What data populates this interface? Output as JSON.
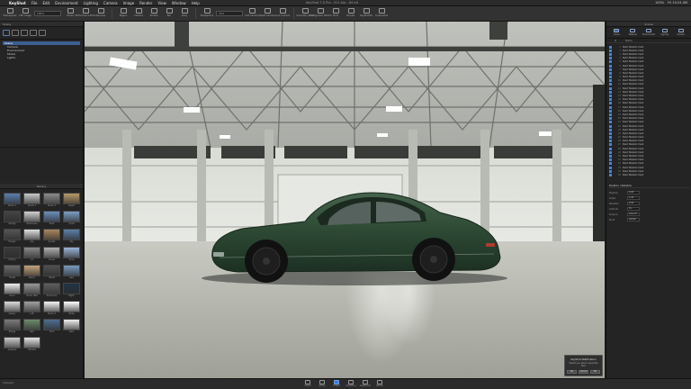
{
  "menubar": {
    "app": "KeyShot",
    "menus": [
      "File",
      "Edit",
      "Environment",
      "Lighting",
      "Camera",
      "Image",
      "Render",
      "View",
      "Window",
      "Help"
    ],
    "title": "KeyShot 7.0 Pro - 911.bip - 64 bit",
    "status": [
      "100%",
      "Fri 10:24 AM"
    ]
  },
  "toolbar": {
    "items": [
      "Workspaces",
      "CPU Usage",
      "Pause",
      "Performance Mode",
      "Denoise",
      "Region",
      "Camera",
      "Tumble",
      "Pan",
      "Dolly",
      "Perspective",
      "Add Camera",
      "Reset Camera",
      "Lock Camera",
      "Geometry View",
      "Configurator Wizard",
      "Tools",
      "Render",
      "KeyShotVR",
      "Screenshot"
    ],
    "cpu_value": "100%",
    "fov_value": "30.0"
  },
  "left_panel": {
    "title": "Scene",
    "tree": [
      "Scene",
      "Camera",
      "Environment",
      "Model",
      "Lights"
    ],
    "library_title": "Library",
    "library_items": [
      "Studio 1",
      "Studio 2",
      "Studio 3",
      "Desert",
      "Garage",
      "Warehouse",
      "Road",
      "Coast",
      "Hangar",
      "City",
      "Sunset",
      "Sky",
      "Factory",
      "Lot",
      "Tunnel",
      "Snow",
      "Forest",
      "Beach",
      "Street",
      "Lake",
      "Room",
      "Studio HDR",
      "Showroom",
      "Night",
      "Gallery",
      "Loft",
      "Studio 4",
      "White",
      "Bridge",
      "Park",
      "Dock",
      "Plain",
      "Gradient",
      "Soft Box"
    ]
  },
  "right_panel": {
    "title": "Scene",
    "tabs": [
      "Scene",
      "Material",
      "Environment",
      "Lighting",
      "Camera"
    ],
    "columns": [
      "",
      "#",
      "Name"
    ],
    "materials": [
      "Paint Metallic Dark",
      "Paint Metallic Dark",
      "Paint Metallic Dark",
      "Paint Metallic Dark",
      "Paint Metallic Dark",
      "Paint Metallic Dark",
      "Paint Metallic Dark",
      "Paint Metallic Dark",
      "Paint Metallic Dark",
      "Paint Metallic Dark",
      "Paint Metallic Dark",
      "Paint Metallic Dark",
      "Paint Metallic Dark",
      "Paint Metallic Dark",
      "Paint Metallic Dark",
      "Paint Metallic Dark",
      "Paint Metallic Dark",
      "Paint Metallic Dark",
      "Paint Metallic Dark",
      "Paint Metallic Dark",
      "Paint Metallic Dark",
      "Paint Metallic Dark",
      "Paint Metallic Dark",
      "Paint Metallic Dark",
      "Paint Metallic Dark",
      "Paint Metallic Dark",
      "Paint Metallic Dark",
      "Paint Metallic Dark",
      "Paint Metallic Dark",
      "Paint Metallic Dark",
      "Paint Metallic Dark",
      "Paint Metallic Dark",
      "Paint Metallic Dark",
      "Paint Metallic Dark",
      "Paint Metallic Dark"
    ],
    "properties_title": "Position / Rotation",
    "properties": [
      {
        "label": "Position",
        "value": "0.00"
      },
      {
        "label": "Scale",
        "value": "1.00"
      },
      {
        "label": "Rotation",
        "value": "0.00"
      },
      {
        "label": "Uniform",
        "value": "On"
      },
      {
        "label": "Snap to",
        "value": "Ground"
      },
      {
        "label": "Pivot",
        "value": "Center"
      }
    ]
  },
  "notification": {
    "title": "KeyShot Notification",
    "message": "Would you like to save this file?",
    "buttons": [
      "Yes",
      "Cancel",
      "No"
    ]
  },
  "bottombar": {
    "camera_label": "Camera",
    "tools": [
      "Import",
      "Library",
      "Project",
      "Animation",
      "KeyShotVR",
      "Render"
    ],
    "active_tool": "Project"
  },
  "colors": {
    "accent": "#3c79d0",
    "car_paint": "#2e4a34",
    "floor": "#b9bab1"
  }
}
